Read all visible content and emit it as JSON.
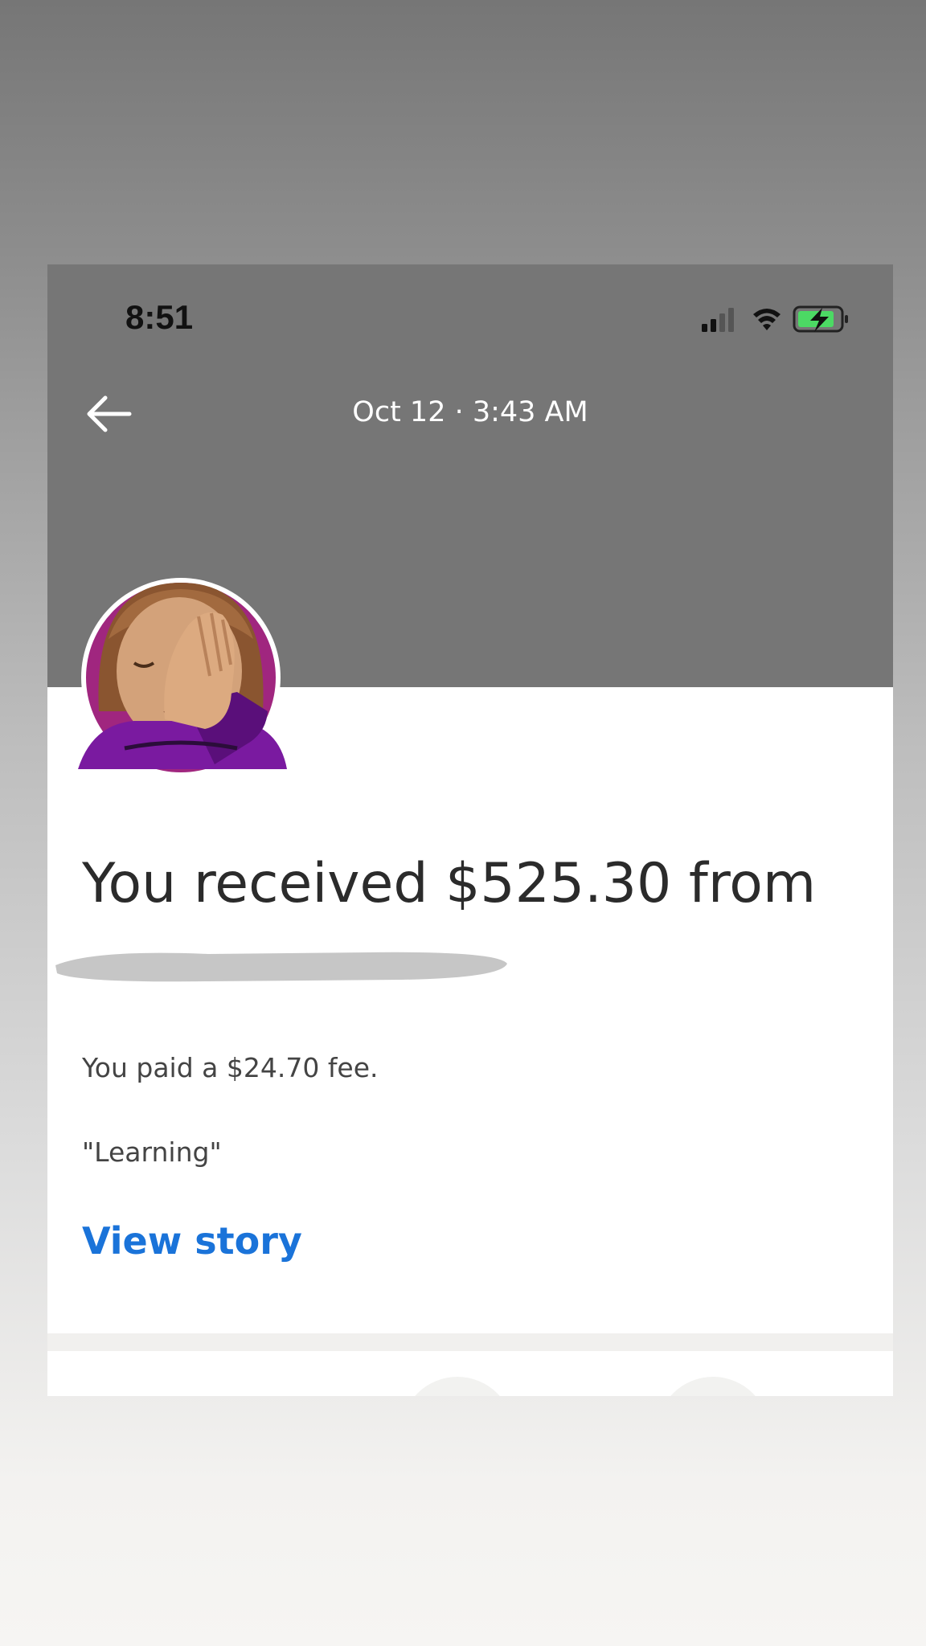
{
  "status_bar": {
    "time": "8:51",
    "icons": [
      "signal-icon",
      "wifi-icon",
      "battery-charging-icon"
    ],
    "battery_color": "#4cd964"
  },
  "header": {
    "back_icon": "back-arrow-icon",
    "title": "Oct 12 · 3:43 AM",
    "band_color": "#767676"
  },
  "avatar": {
    "icon": "person-facepalming-emoji",
    "ring_color": "#a0267f"
  },
  "transaction": {
    "headline": "You received $525.30 from",
    "fee_text": "You paid a $24.70 fee.",
    "note": "\"Learning\"",
    "view_story_label": "View story",
    "link_color": "#1a73d9"
  }
}
